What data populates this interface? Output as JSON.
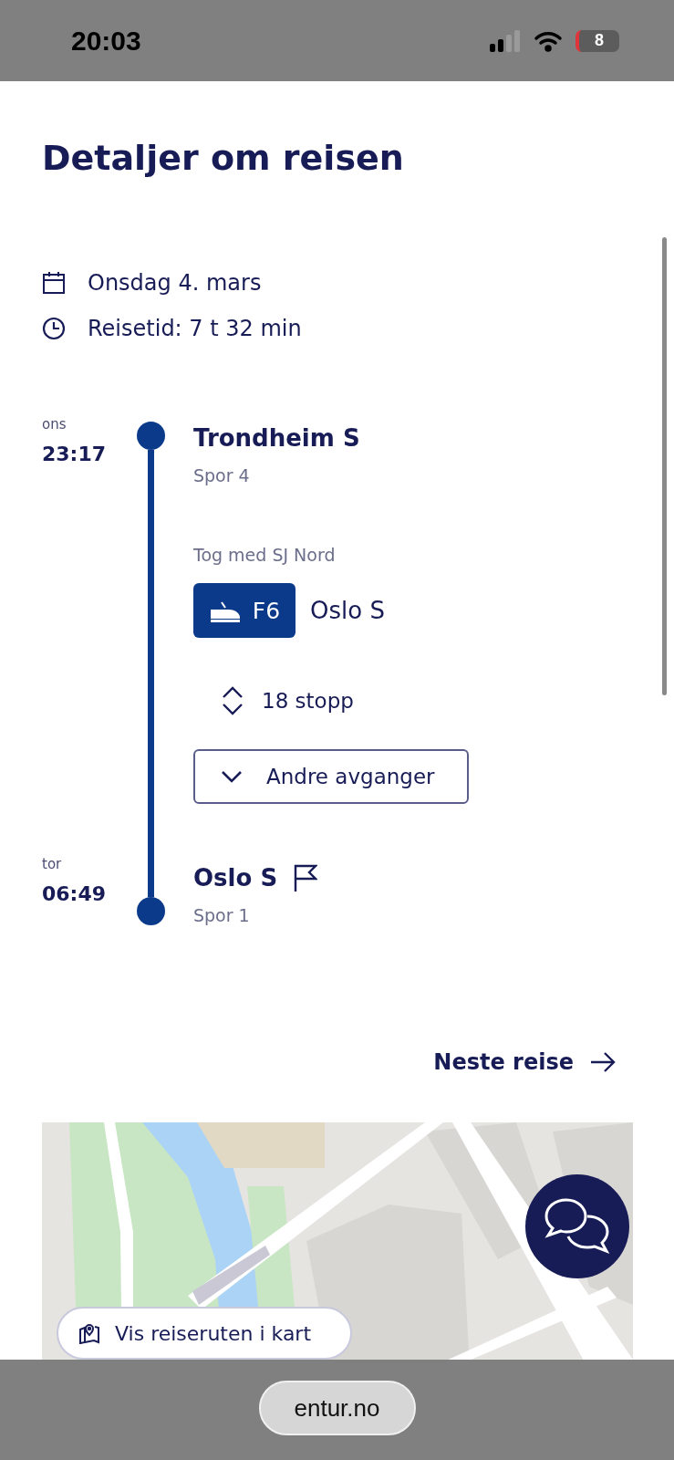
{
  "status_bar": {
    "time": "20:03",
    "battery": "8"
  },
  "title": "Detaljer om reisen",
  "summary": [
    {
      "kind": "date",
      "text": "Onsdag 4. mars"
    },
    {
      "kind": "duration",
      "text": "Reisetid: 7 t 32 min"
    }
  ],
  "trip": {
    "departure": {
      "day": "ons",
      "time": "23:17",
      "station": "Trondheim S",
      "platform": "Spor 4"
    },
    "leg": {
      "operator": "Tog med SJ Nord",
      "line": "F6",
      "destination": "Oslo S",
      "stops": "18 stopp",
      "other_departures": "Andre avganger"
    },
    "arrival": {
      "day": "tor",
      "time": "06:49",
      "station": "Oslo S",
      "platform": "Spor 1"
    }
  },
  "next_trip": "Neste reise",
  "map": {
    "kind": "picture",
    "button": "Vis reiseruten i kart"
  },
  "browser": {
    "url": "entur.no"
  }
}
